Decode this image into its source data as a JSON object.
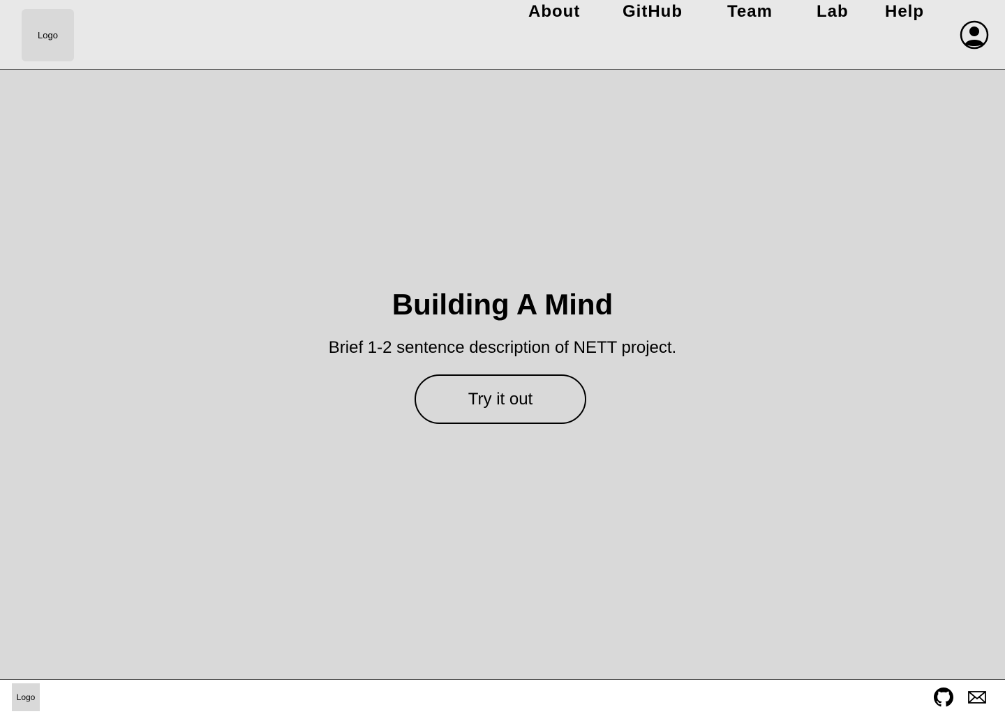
{
  "header": {
    "logo_label": "Logo",
    "nav": [
      {
        "label": "About"
      },
      {
        "label": "GitHub"
      },
      {
        "label": "Team"
      },
      {
        "label": "Lab"
      },
      {
        "label": "Help"
      }
    ],
    "account_icon": "account-circle-icon"
  },
  "hero": {
    "title": "Building A Mind",
    "description": "Brief 1-2 sentence description of NETT project.",
    "cta_label": "Try it out"
  },
  "footer": {
    "logo_label": "Logo",
    "icons": [
      "github-icon",
      "mail-icon"
    ]
  },
  "colors": {
    "page_background": "#d9d9d9",
    "header_background": "#e8e8e8",
    "footer_background": "#ffffff",
    "text": "#000000"
  }
}
